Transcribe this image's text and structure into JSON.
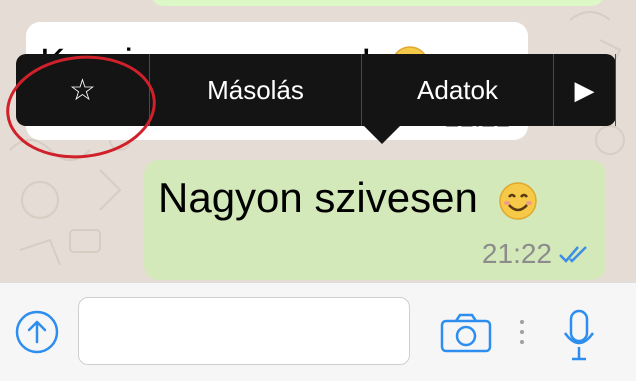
{
  "colors": {
    "chat_background": "#e5ddd5",
    "incoming_bubble": "#ffffff",
    "outgoing_bubble": "#d4e9b9",
    "menu_background": "#141414",
    "accent_blue": "#2d8ef0",
    "annotation_red": "#d0202a"
  },
  "messages": [
    {
      "direction": "incoming",
      "text": "Koszi meg egyszer!",
      "time": "21:21"
    },
    {
      "direction": "outgoing",
      "text": "Nagyon szivesen",
      "time": "21:22",
      "status": "read-double-check"
    }
  ],
  "context_menu": {
    "star_label": "☆",
    "copy_label": "Másolás",
    "info_label": "Adatok",
    "more_label": "▶"
  },
  "input_bar": {
    "message_value": "",
    "icons": [
      "upload-arrow-icon",
      "camera-icon",
      "microphone-icon"
    ]
  }
}
